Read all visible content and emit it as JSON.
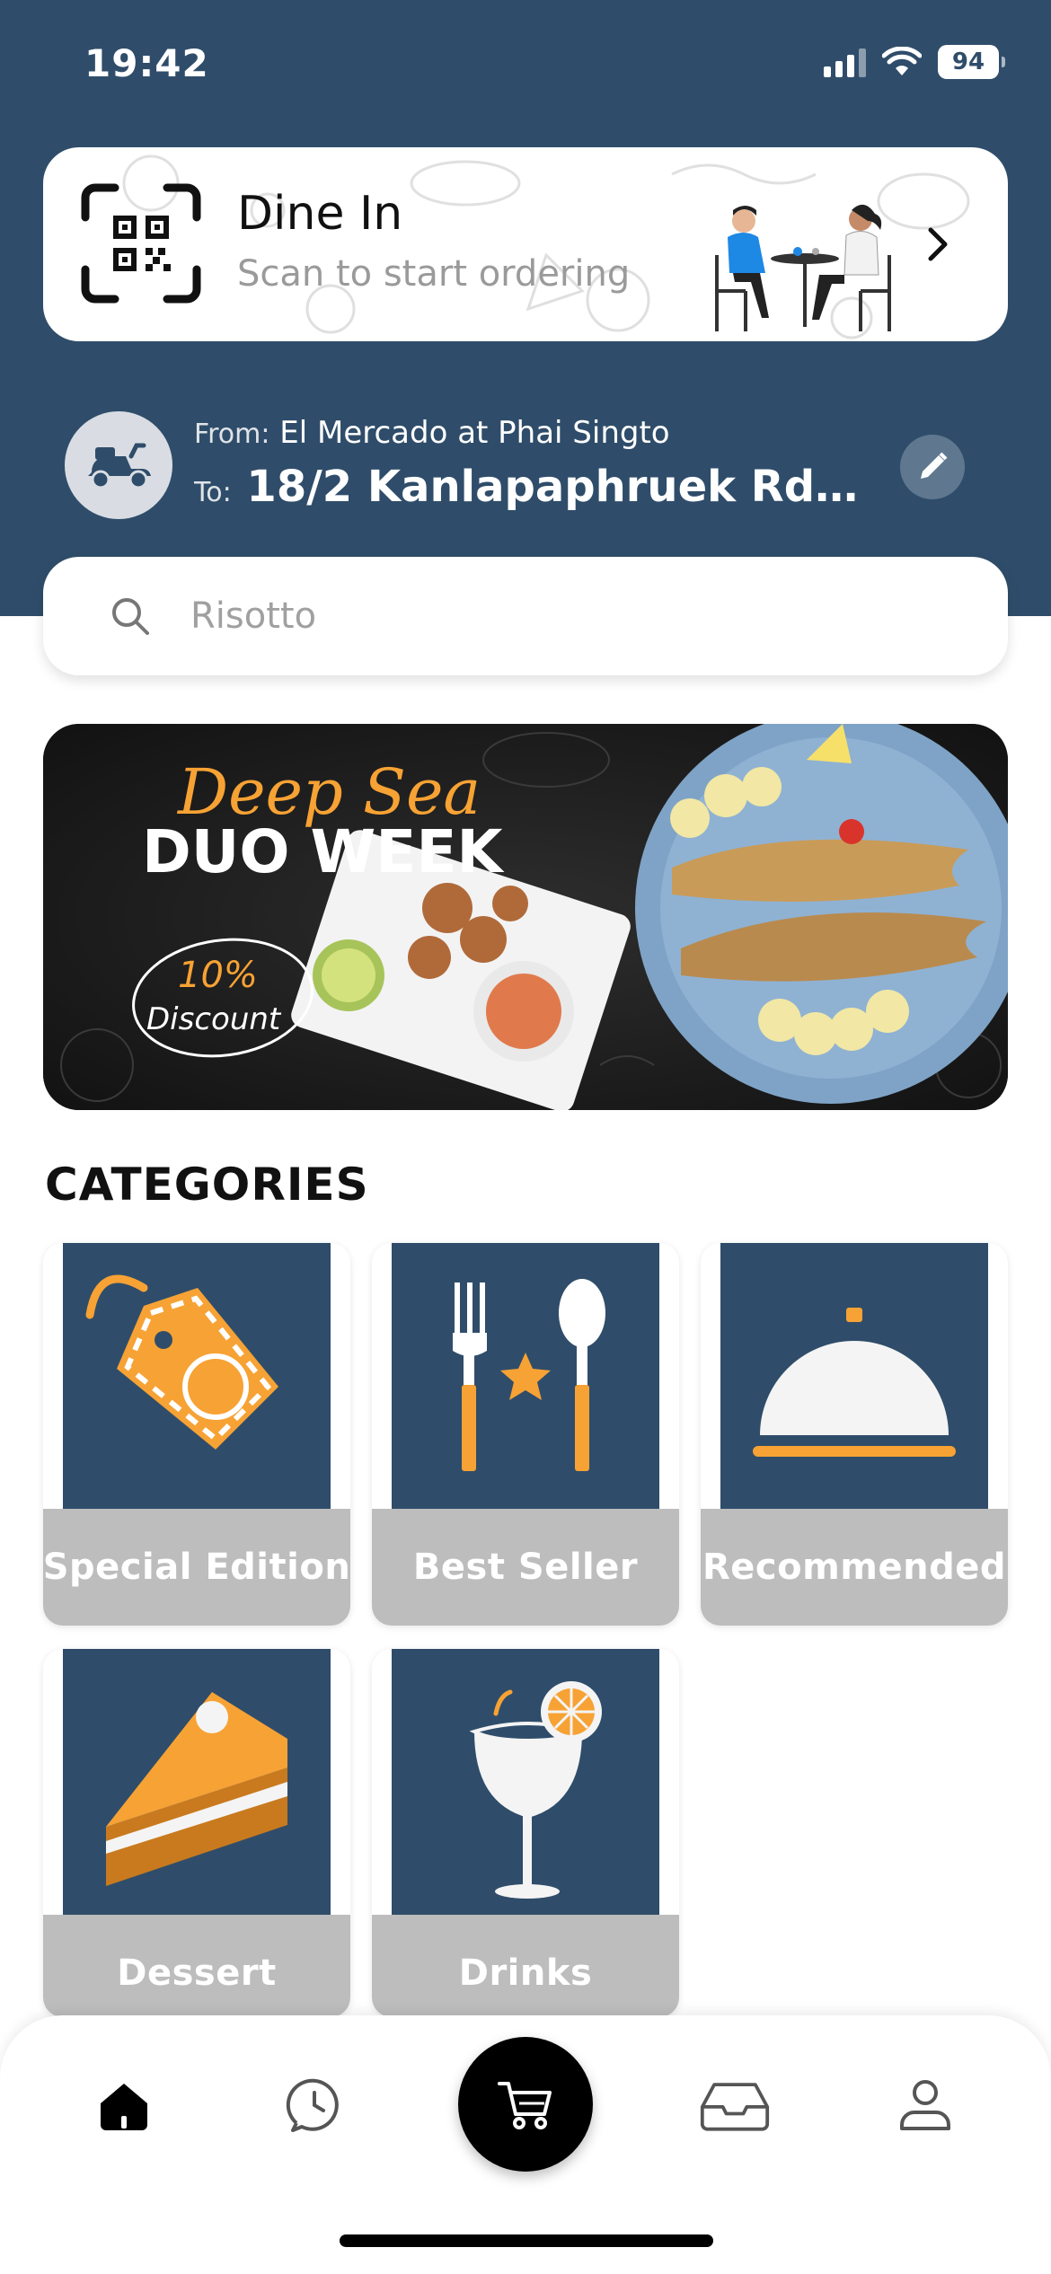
{
  "status_bar": {
    "time": "19:42",
    "battery": "94"
  },
  "dine_in": {
    "title": "Dine In",
    "subtitle": "Scan to start ordering"
  },
  "delivery": {
    "from_label": "From:",
    "from_value": "El Mercado at Phai Singto",
    "to_label": "To:",
    "to_value": "18/2 Kanlapaphruek Rd, Kh..."
  },
  "search": {
    "placeholder": "Risotto"
  },
  "banner": {
    "script_text": "Deep Sea",
    "headline": "DUO WEEK",
    "discount_line1": "10%",
    "discount_line2": "Discount"
  },
  "categories": {
    "title": "CATEGORIES",
    "items": [
      {
        "label": "Special Edition",
        "icon": "price-tag-icon"
      },
      {
        "label": "Best Seller",
        "icon": "cutlery-star-icon"
      },
      {
        "label": "Recommended",
        "icon": "cloche-icon"
      },
      {
        "label": "Dessert",
        "icon": "cake-slice-icon"
      },
      {
        "label": "Drinks",
        "icon": "cocktail-glass-icon"
      }
    ]
  },
  "bottom_nav": {
    "items": [
      "home-icon",
      "history-icon",
      "cart-icon",
      "inbox-icon",
      "profile-icon"
    ],
    "active": "home-icon"
  },
  "colors": {
    "header": "#2f4d6a",
    "accent": "#f7a234",
    "label_bg": "#bdbdbd"
  }
}
